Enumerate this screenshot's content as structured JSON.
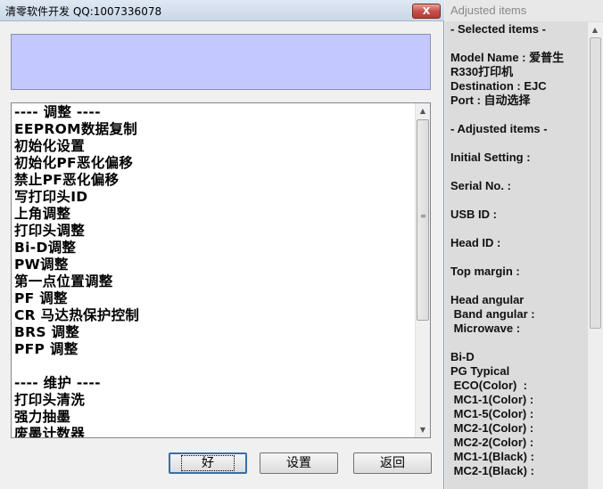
{
  "window": {
    "title": "清零软件开发 QQ:1007336078",
    "close_label": "X"
  },
  "list": {
    "items": [
      "---- 调整 ----",
      "EEPROM数据复制",
      "初始化设置",
      "初始化PF恶化偏移",
      "禁止PF恶化偏移",
      "写打印头ID",
      "上角调整",
      "打印头调整",
      "Bi-D调整",
      "PW调整",
      "第一点位置调整",
      "PF 调整",
      "CR 马达热保护控制",
      "BRS 调整",
      "PFP 调整",
      "",
      "---- 维护 ----",
      "打印头清洗",
      "强力抽墨",
      "废墨计数器"
    ]
  },
  "buttons": {
    "ok": "好",
    "settings": "设置",
    "back": "返回"
  },
  "side_panel": {
    "title": "Adjusted items",
    "lines": [
      "- Selected items -",
      "",
      "Model Name : 爱普生",
      "R330打印机",
      "Destination : EJC",
      "Port : 自动选择",
      "",
      "- Adjusted items -",
      "",
      "Initial Setting :",
      "",
      "Serial No. :",
      "",
      "USB ID :",
      "",
      "Head ID :",
      "",
      "Top margin :",
      "",
      "Head angular",
      " Band angular :",
      " Microwave :",
      "",
      "Bi-D",
      "PG Typical",
      " ECO(Color)  :",
      " MC1-1(Color) :",
      " MC1-5(Color) :",
      " MC2-1(Color) :",
      " MC2-2(Color) :",
      " MC1-1(Black) :",
      " MC2-1(Black) :"
    ]
  },
  "colors": {
    "top_box": "#c3c8ff",
    "close_button": "#c75050"
  }
}
